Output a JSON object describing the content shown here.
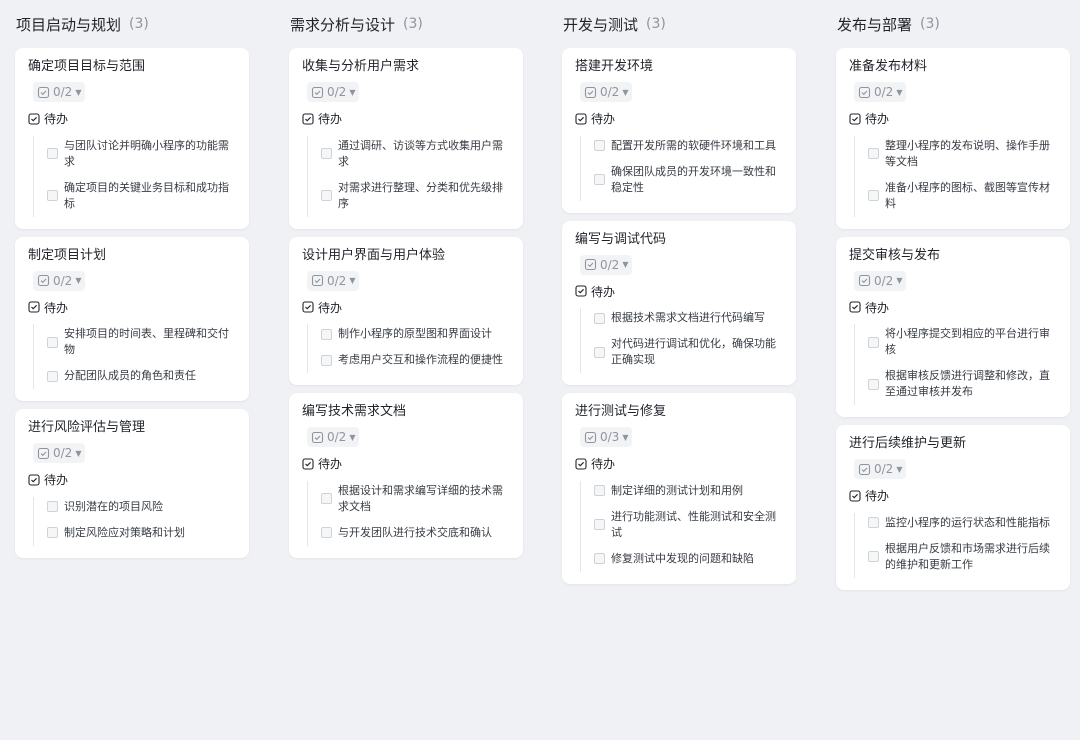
{
  "columns": [
    {
      "title": "项目启动与规划",
      "count": "(3)",
      "cards": [
        {
          "title": "确定项目目标与范围",
          "progress": "0/2",
          "group": "待办",
          "todos": [
            "与团队讨论并明确小程序的功能需求",
            "确定项目的关键业务目标和成功指标"
          ]
        },
        {
          "title": "制定项目计划",
          "progress": "0/2",
          "group": "待办",
          "todos": [
            "安排项目的时间表、里程碑和交付物",
            "分配团队成员的角色和责任"
          ]
        },
        {
          "title": "进行风险评估与管理",
          "progress": "0/2",
          "group": "待办",
          "todos": [
            "识别潜在的项目风险",
            "制定风险应对策略和计划"
          ]
        }
      ]
    },
    {
      "title": "需求分析与设计",
      "count": "(3)",
      "cards": [
        {
          "title": "收集与分析用户需求",
          "progress": "0/2",
          "group": "待办",
          "todos": [
            "通过调研、访谈等方式收集用户需求",
            "对需求进行整理、分类和优先级排序"
          ]
        },
        {
          "title": "设计用户界面与用户体验",
          "progress": "0/2",
          "group": "待办",
          "todos": [
            "制作小程序的原型图和界面设计",
            "考虑用户交互和操作流程的便捷性"
          ]
        },
        {
          "title": "编写技术需求文档",
          "progress": "0/2",
          "group": "待办",
          "todos": [
            "根据设计和需求编写详细的技术需求文档",
            "与开发团队进行技术交底和确认"
          ]
        }
      ]
    },
    {
      "title": "开发与测试",
      "count": "(3)",
      "cards": [
        {
          "title": "搭建开发环境",
          "progress": "0/2",
          "group": "待办",
          "todos": [
            "配置开发所需的软硬件环境和工具",
            "确保团队成员的开发环境一致性和稳定性"
          ]
        },
        {
          "title": "编写与调试代码",
          "progress": "0/2",
          "group": "待办",
          "todos": [
            "根据技术需求文档进行代码编写",
            "对代码进行调试和优化，确保功能正确实现"
          ]
        },
        {
          "title": "进行测试与修复",
          "progress": "0/3",
          "group": "待办",
          "todos": [
            "制定详细的测试计划和用例",
            "进行功能测试、性能测试和安全测试",
            "修复测试中发现的问题和缺陷"
          ]
        }
      ]
    },
    {
      "title": "发布与部署",
      "count": "(3)",
      "cards": [
        {
          "title": "准备发布材料",
          "progress": "0/2",
          "group": "待办",
          "todos": [
            "整理小程序的发布说明、操作手册等文档",
            "准备小程序的图标、截图等宣传材料"
          ]
        },
        {
          "title": "提交审核与发布",
          "progress": "0/2",
          "group": "待办",
          "todos": [
            "将小程序提交到相应的平台进行审核",
            "根据审核反馈进行调整和修改，直至通过审核并发布"
          ]
        },
        {
          "title": "进行后续维护与更新",
          "progress": "0/2",
          "group": "待办",
          "todos": [
            "监控小程序的运行状态和性能指标",
            "根据用户反馈和市场需求进行后续的维护和更新工作"
          ]
        }
      ]
    }
  ],
  "icons": {
    "progress": "checklist-icon",
    "group": "checkbox-icon",
    "caret": "caret-down-icon"
  },
  "colors": {
    "background": "#f0f1f4",
    "card": "#ffffff",
    "muted_text": "#8f959e"
  }
}
